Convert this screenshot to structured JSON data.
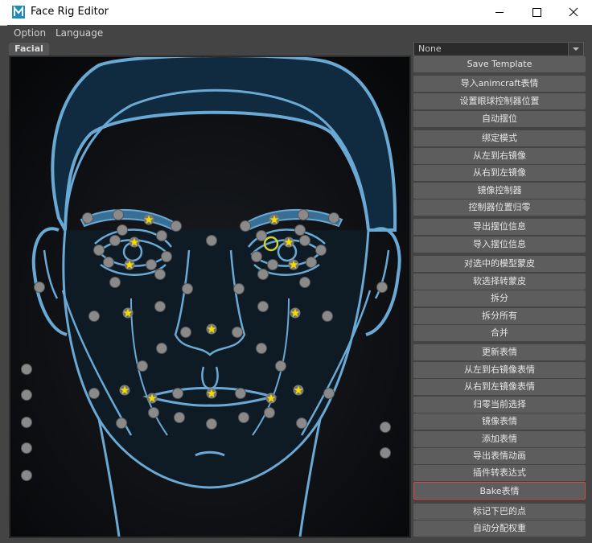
{
  "window": {
    "title": "Face Rig Editor",
    "app_icon": "maya-icon"
  },
  "menu": [
    "Option",
    "Language"
  ],
  "tab": "Facial",
  "template_select": {
    "value": "None"
  },
  "buttons": [
    "Save Template",
    "导入animcraft表情",
    "设置眼球控制器位置",
    "自动摆位",
    "绑定模式",
    "从左到右镜像",
    "从右到左镜像",
    "镜像控制器",
    "控制器位置归零",
    "导出摆位信息",
    "导入摆位信息",
    "对选中的模型蒙皮",
    "软选择转蒙皮",
    "拆分",
    "拆分所有",
    "合并",
    "更新表情",
    "从左到右镜像表情",
    "从右到左镜像表情",
    "归零当前选择",
    "镜像表情",
    "添加表情",
    "导出表情动画",
    "插件转表达式",
    "Bake表情",
    "标记下巴的点",
    "自动分配权重"
  ],
  "colors": {
    "face_line": "#6aa9d4",
    "face_fill": "#0f1e2b",
    "hair_fill": "#0f2a40",
    "point": "#888888",
    "star": "#e8d100",
    "highlight_border": "#d24a4a"
  }
}
